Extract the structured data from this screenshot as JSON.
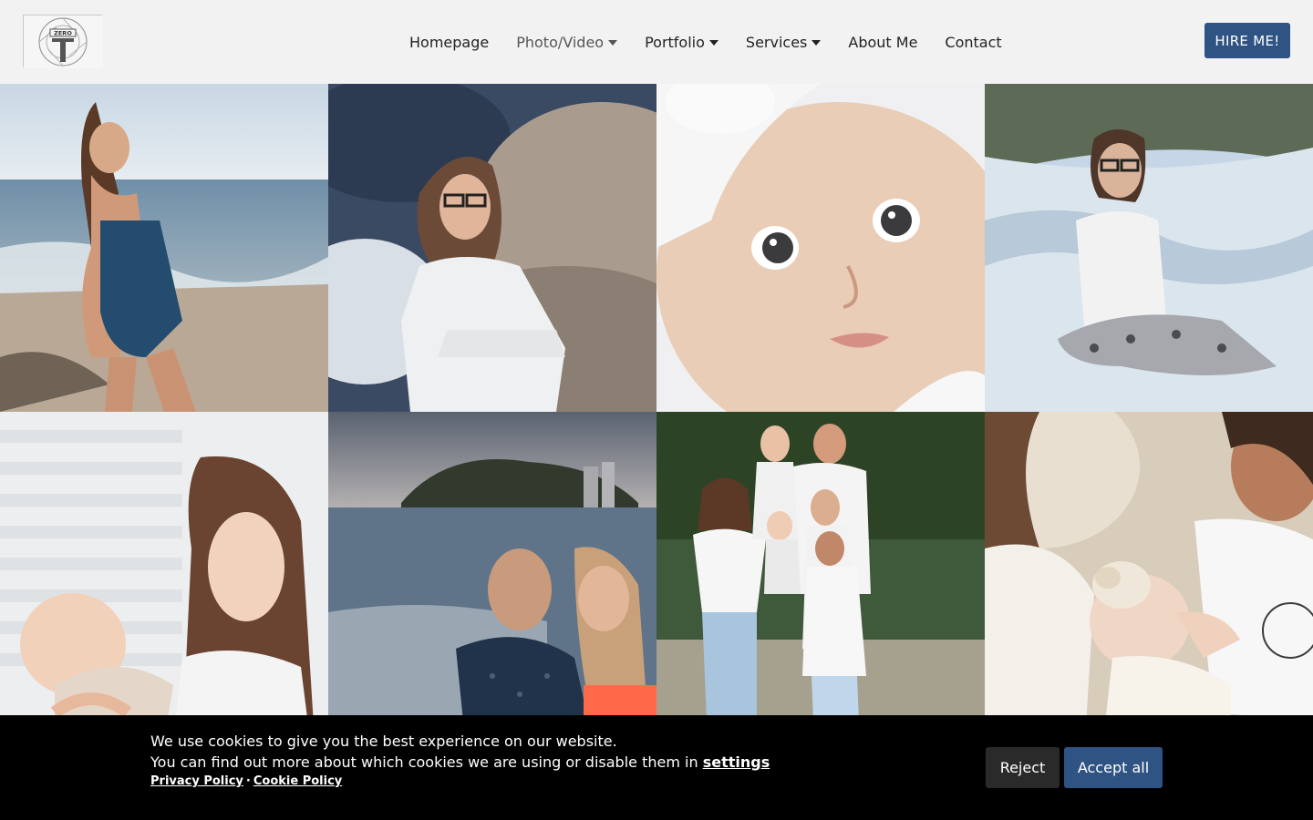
{
  "header": {
    "logo_text": "ZERO",
    "nav": [
      {
        "label": "Homepage",
        "has_dropdown": false
      },
      {
        "label": "Photo/Video",
        "has_dropdown": true,
        "active": true
      },
      {
        "label": "Portfolio",
        "has_dropdown": true
      },
      {
        "label": "Services",
        "has_dropdown": true
      },
      {
        "label": "About Me",
        "has_dropdown": false
      },
      {
        "label": "Contact",
        "has_dropdown": false
      }
    ],
    "hire_label": "HIRE ME!"
  },
  "gallery": {
    "photos": [
      {
        "subject": "woman-in-swimsuit-on-beach"
      },
      {
        "subject": "woman-with-glasses-by-rocks"
      },
      {
        "subject": "baby-closeup-with-headband"
      },
      {
        "subject": "woman-sitting-on-sand"
      },
      {
        "subject": "mother-holding-baby-by-window"
      },
      {
        "subject": "couple-embracing-on-beach"
      },
      {
        "subject": "family-portrait-on-beach"
      },
      {
        "subject": "parents-with-baby-closeup"
      }
    ]
  },
  "cookie": {
    "line1": "We use cookies to give you the best experience on our website.",
    "line2_prefix": "You can find out more about which cookies we are using or disable them in ",
    "settings_label": "settings",
    "privacy_label": "Privacy Policy",
    "separator": "·",
    "cookie_policy_label": "Cookie Policy",
    "reject_label": "Reject",
    "accept_label": "Accept all"
  },
  "colors": {
    "accent": "#2f5383",
    "header_bg": "#f2f2f2",
    "banner_bg": "#000000"
  }
}
